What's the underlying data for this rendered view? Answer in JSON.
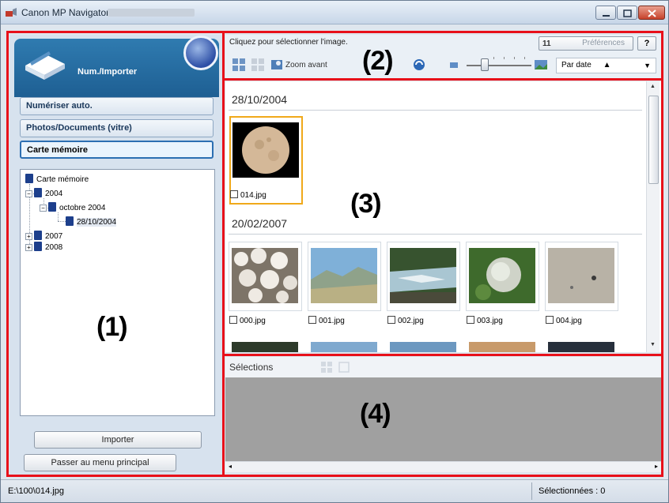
{
  "window": {
    "title": "Canon MP Navigator EX"
  },
  "left_panel": {
    "header_title": "Num./Importer",
    "menu": [
      {
        "label": "Numériser auto."
      },
      {
        "label": "Photos/Documents (vitre)"
      },
      {
        "label": "Carte mémoire",
        "active": true
      }
    ],
    "tree": {
      "root": "Carte mémoire",
      "y2004": "2004",
      "month": "octobre 2004",
      "day": "28/10/2004",
      "y2007": "2007",
      "y2008": "2008"
    },
    "import_button": "Importer",
    "main_menu_button": "Passer au menu principal"
  },
  "toolbar": {
    "hint": "Cliquez pour sélectionner l'image.",
    "preferences": "Préférences",
    "preferences_icon": "11",
    "help": "?",
    "zoom_label": "Zoom avant",
    "sort_label": "Par date",
    "sort_arrow": "▲",
    "sort_dropdown": "▼"
  },
  "gallery": {
    "groups": [
      {
        "date": "28/10/2004",
        "items": [
          {
            "name": "014.jpg",
            "selected": true
          }
        ]
      },
      {
        "date": "20/02/2007",
        "items": [
          {
            "name": "000.jpg"
          },
          {
            "name": "001.jpg"
          },
          {
            "name": "002.jpg"
          },
          {
            "name": "003.jpg"
          },
          {
            "name": "004.jpg"
          }
        ]
      }
    ]
  },
  "selections": {
    "title": "Sélections"
  },
  "annotations": {
    "n1": "(1)",
    "n2": "(2)",
    "n3": "(3)",
    "n4": "(4)"
  },
  "status": {
    "path": "E:\\100\\014.jpg",
    "selected": "Sélectionnées : 0"
  },
  "colors": {
    "annotation": "#e8101a",
    "selected_thumb": "#f0a91a",
    "header_blue": "#1e5f93"
  }
}
